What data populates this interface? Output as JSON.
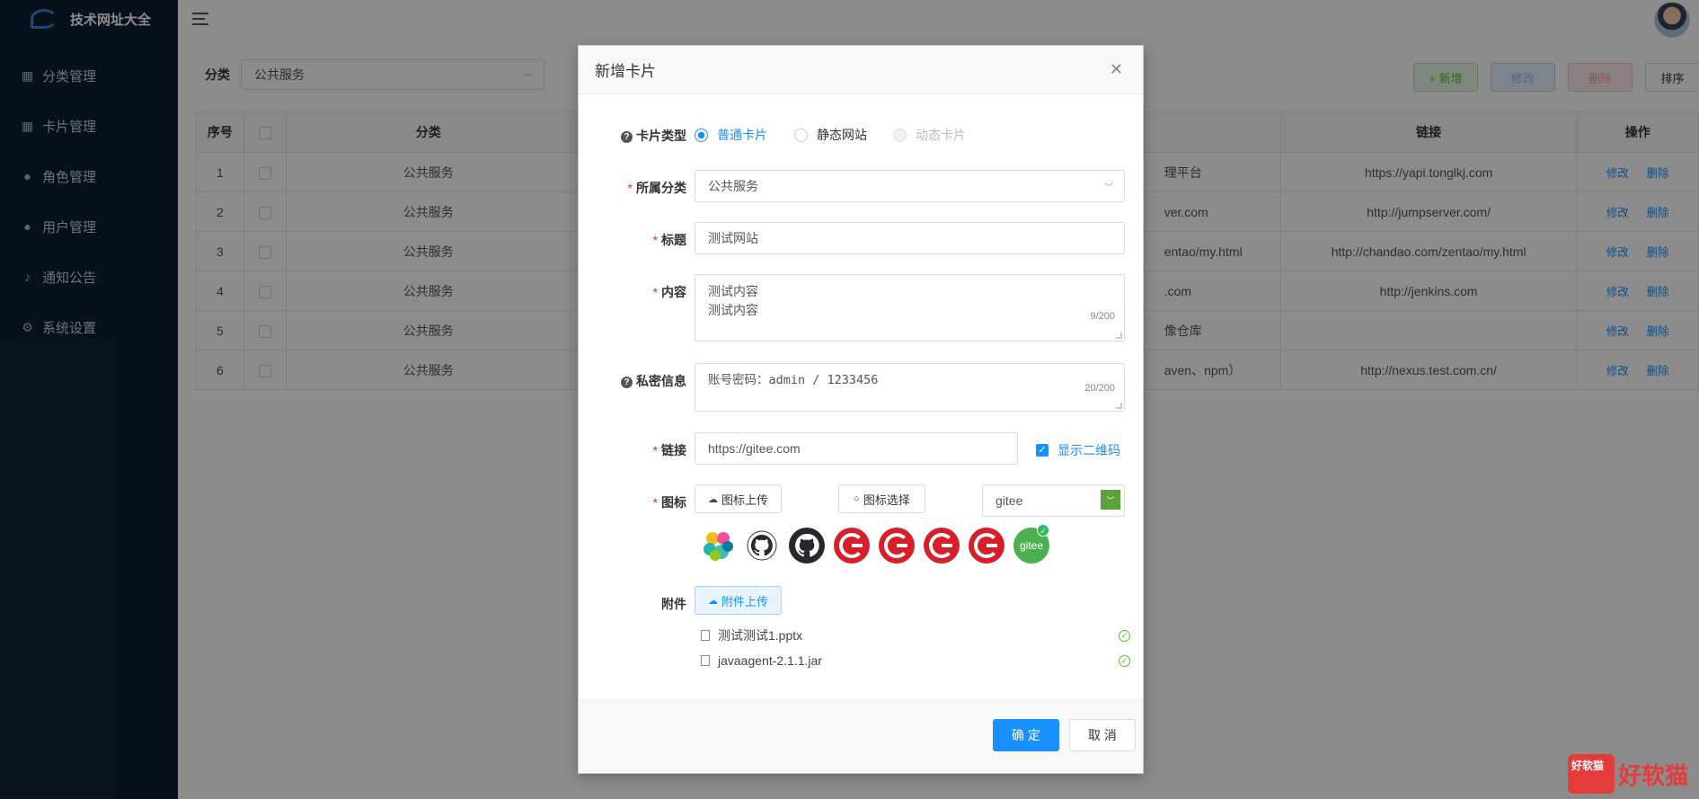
{
  "app": {
    "title": "技术网址大全"
  },
  "sidebar": {
    "items": [
      {
        "label": "分类管理",
        "icon": "grid-icon"
      },
      {
        "label": "卡片管理",
        "icon": "apps-icon"
      },
      {
        "label": "角色管理",
        "icon": "person-icon"
      },
      {
        "label": "用户管理",
        "icon": "user-icon"
      },
      {
        "label": "通知公告",
        "icon": "bell-icon"
      },
      {
        "label": "系统设置",
        "icon": "gear-icon"
      }
    ]
  },
  "page": {
    "filter_label": "分类",
    "filter_value": "公共服务",
    "toolbar": {
      "add": "+ 新增",
      "edit": "修改",
      "delete": "删除",
      "sort": "排序"
    },
    "table": {
      "headers": {
        "index": "序号",
        "category": "分类",
        "link": "链接",
        "ops": "操作"
      },
      "rows": [
        {
          "index": "1",
          "category": "公共服务",
          "title_tail": "理平台",
          "link": "https://yapi.tonglkj.com"
        },
        {
          "index": "2",
          "category": "公共服务",
          "title_tail": "ver.com",
          "link": "http://jumpserver.com/"
        },
        {
          "index": "3",
          "category": "公共服务",
          "title_tail": "entao/my.html",
          "link": "http://chandao.com/zentao/my.html"
        },
        {
          "index": "4",
          "category": "公共服务",
          "title_tail": ".com",
          "link": "http://jenkins.com"
        },
        {
          "index": "5",
          "category": "公共服务",
          "title_tail": "像仓库",
          "link": ""
        },
        {
          "index": "6",
          "category": "公共服务",
          "title_tail": "aven、npm）",
          "link": "http://nexus.test.com.cn/"
        }
      ],
      "edit_label": "修改",
      "delete_label": "删除"
    }
  },
  "modal": {
    "title": "新增卡片",
    "card_type": {
      "label": "卡片类型",
      "options": [
        "普通卡片",
        "静态网站",
        "动态卡片"
      ]
    },
    "category": {
      "label": "所属分类",
      "value": "公共服务"
    },
    "title_field": {
      "label": "标题",
      "value": "测试网站"
    },
    "content": {
      "label": "内容",
      "line1": "测试内容",
      "line2": "测试内容",
      "counter": "9/200"
    },
    "private": {
      "label": "私密信息",
      "value": "账号密码：admin / 1233456",
      "counter": "20/200"
    },
    "link": {
      "label": "链接",
      "value": "https://gitee.com",
      "qr_label": "显示二维码"
    },
    "icon": {
      "label": "图标",
      "upload": "图标上传",
      "select": "图标选择",
      "search_value": "gitee",
      "gitee_text": "gitee"
    },
    "attachment": {
      "label": "附件",
      "upload": "附件上传",
      "files": [
        "测试测试1.pptx",
        "javaagent-2.1.1.jar"
      ]
    },
    "ok": "确 定",
    "cancel": "取 消"
  },
  "watermark": {
    "badge": "好软猫",
    "text": "好软猫"
  }
}
